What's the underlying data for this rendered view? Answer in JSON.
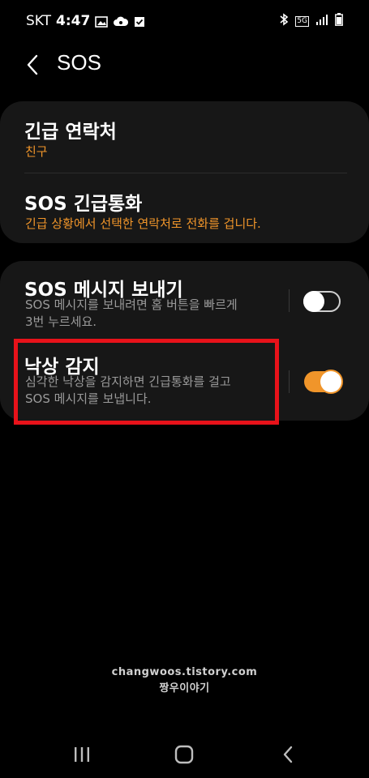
{
  "status_bar": {
    "carrier": "SKT",
    "time": "4:47",
    "network": "5G"
  },
  "header": {
    "title": "SOS"
  },
  "card1": {
    "emergency_contacts": {
      "title": "긴급 연락처",
      "subtitle": "친구"
    },
    "sos_call": {
      "title": "SOS 긴급통화",
      "subtitle": "긴급 상황에서 선택한 연락처로 전화를 겁니다."
    }
  },
  "card2": {
    "send_sos": {
      "title": "SOS 메시지 보내기",
      "subtitle_line1": "SOS 메시지를 보내려면 홈 버튼을 빠르게",
      "subtitle_line2": "3번 누르세요.",
      "enabled": false
    },
    "fall_detection": {
      "title": "낙상 감지",
      "subtitle_line1": "심각한 낙상을 감지하면 긴급통화를 걸고",
      "subtitle_line2": "SOS 메시지를 보냅니다.",
      "enabled": true
    }
  },
  "watermark": {
    "line1": "changwoos.tistory.com",
    "line2": "짱우이야기"
  },
  "colors": {
    "accent": "#f0952a",
    "highlight": "#e8121a",
    "card_bg": "#171717"
  }
}
